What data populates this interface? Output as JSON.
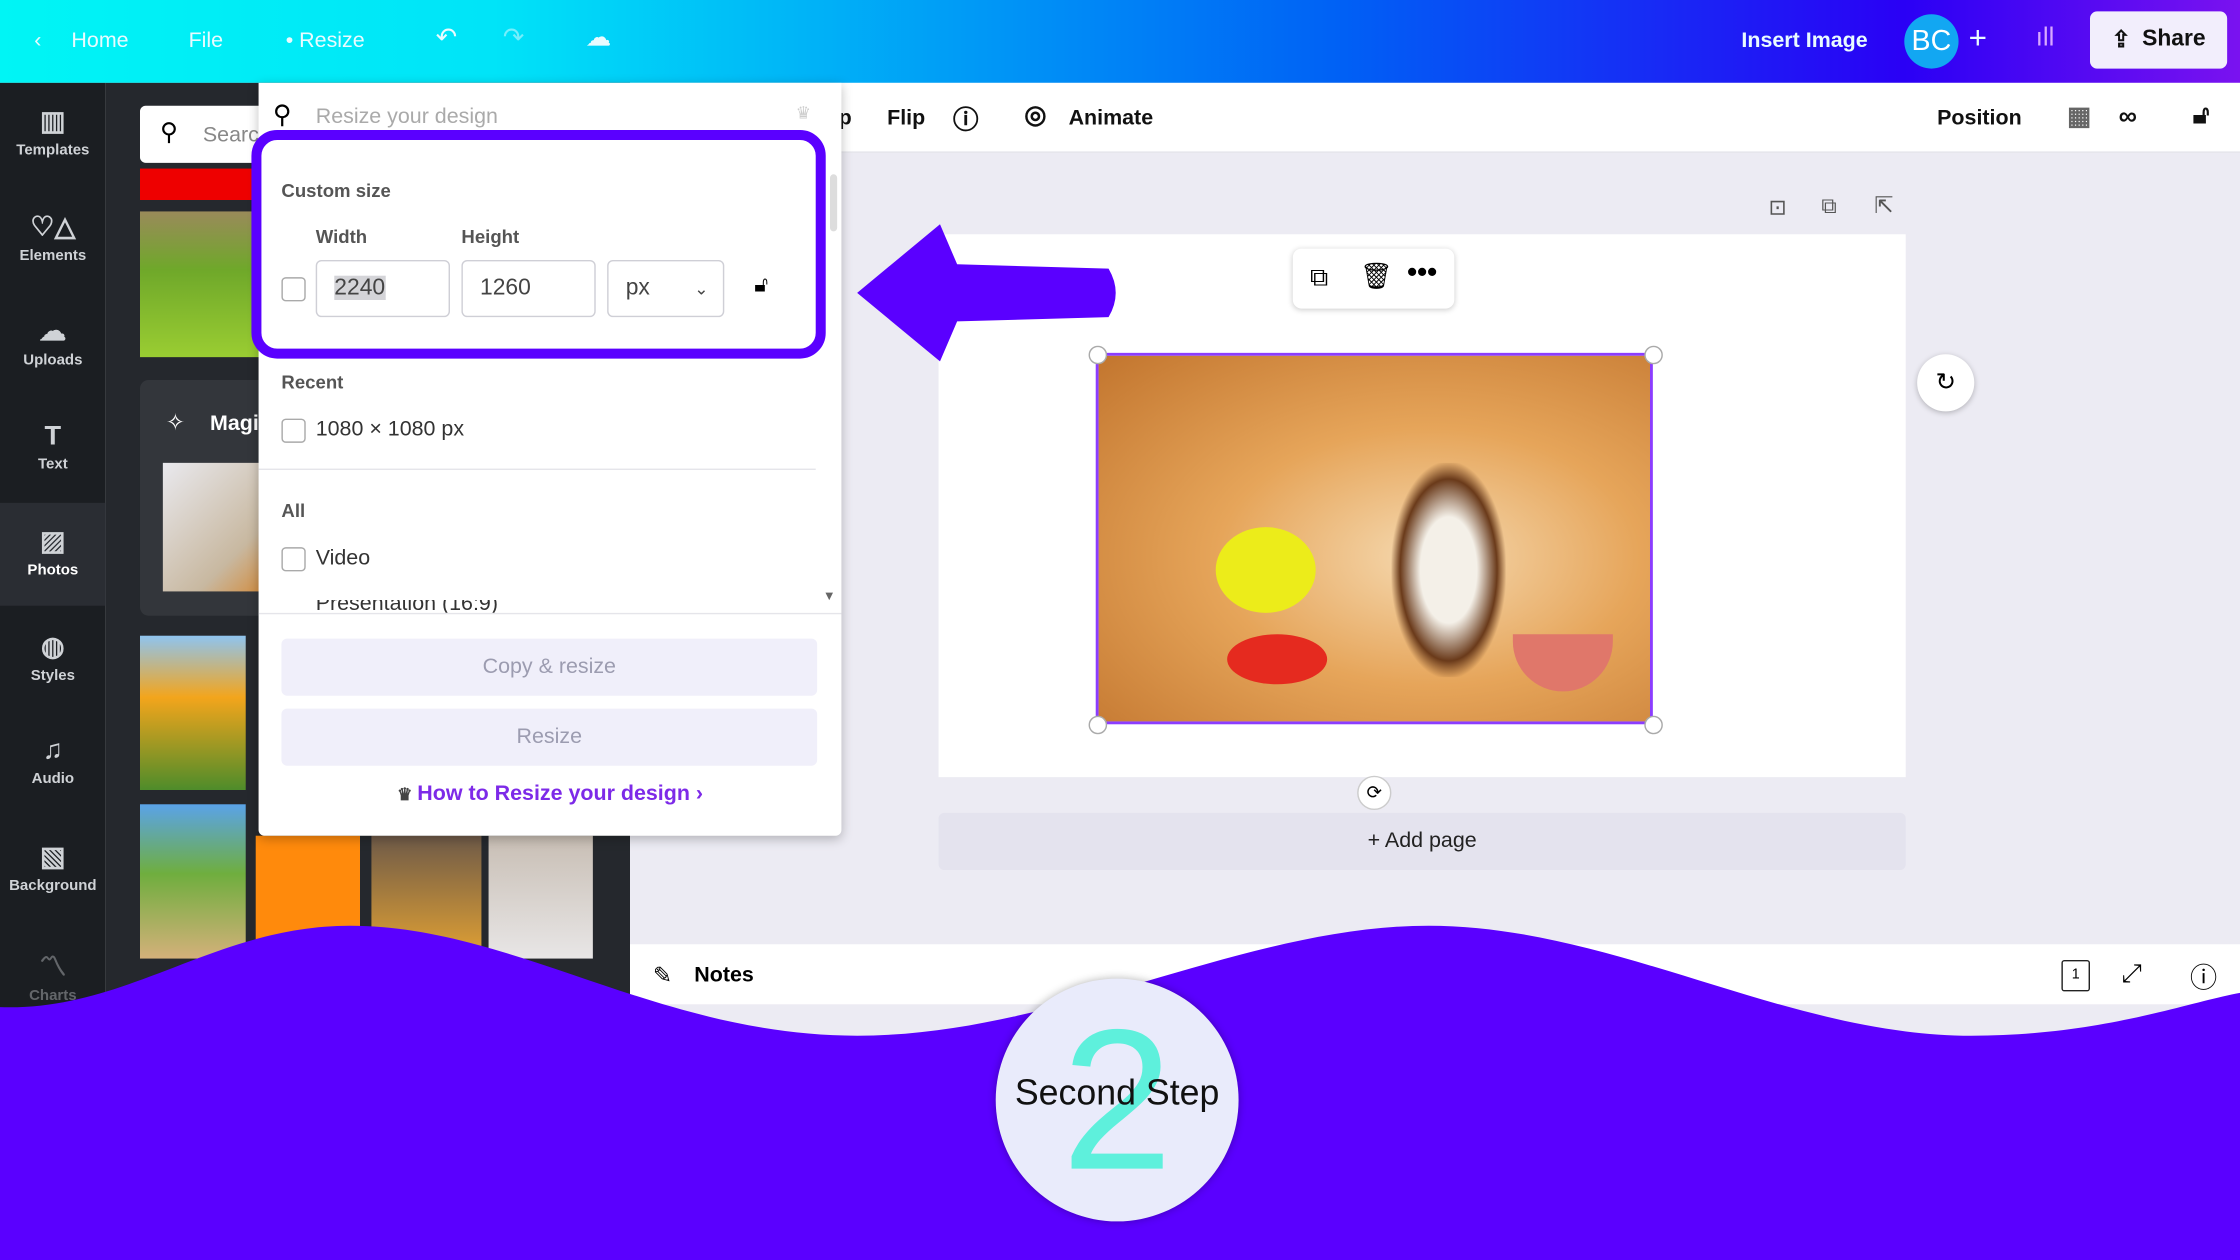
{
  "topbar": {
    "home": "Home",
    "file": "File",
    "resize": "Resize",
    "insert_image": "Insert Image",
    "avatar_initials": "BC",
    "share": "Share"
  },
  "sidebar": {
    "items": [
      {
        "label": "Templates",
        "icon": "templates-icon"
      },
      {
        "label": "Elements",
        "icon": "elements-icon"
      },
      {
        "label": "Uploads",
        "icon": "upload-icon"
      },
      {
        "label": "Text",
        "icon": "text-icon"
      },
      {
        "label": "Photos",
        "icon": "photos-icon",
        "active": true
      },
      {
        "label": "Styles",
        "icon": "palette-icon"
      },
      {
        "label": "Audio",
        "icon": "music-icon"
      },
      {
        "label": "Background",
        "icon": "background-icon"
      },
      {
        "label": "Charts",
        "icon": "chart-icon"
      }
    ]
  },
  "panel": {
    "search_placeholder": "Searc",
    "magic_label": "Magi"
  },
  "toolbar": {
    "crop_partial": "p",
    "flip": "Flip",
    "animate": "Animate",
    "position": "Position"
  },
  "resize_menu": {
    "search_placeholder": "Resize your design",
    "custom_size": "Custom size",
    "width_label": "Width",
    "height_label": "Height",
    "width_value": "2240",
    "height_value": "1260",
    "unit": "px",
    "recent_label": "Recent",
    "recent_items": [
      "1080 × 1080 px"
    ],
    "all_label": "All",
    "all_items": [
      "Video",
      "Presentation (16:9)"
    ],
    "copy_resize": "Copy & resize",
    "resize": "Resize",
    "help_link": "How to Resize your design"
  },
  "canvas": {
    "add_page": "+ Add page",
    "page_count": "1"
  },
  "bottom": {
    "notes": "Notes"
  },
  "overlay": {
    "step_number": "2",
    "step_text": "Second Step",
    "accent": "#5a00ff",
    "number_color": "#5ef0dc"
  }
}
